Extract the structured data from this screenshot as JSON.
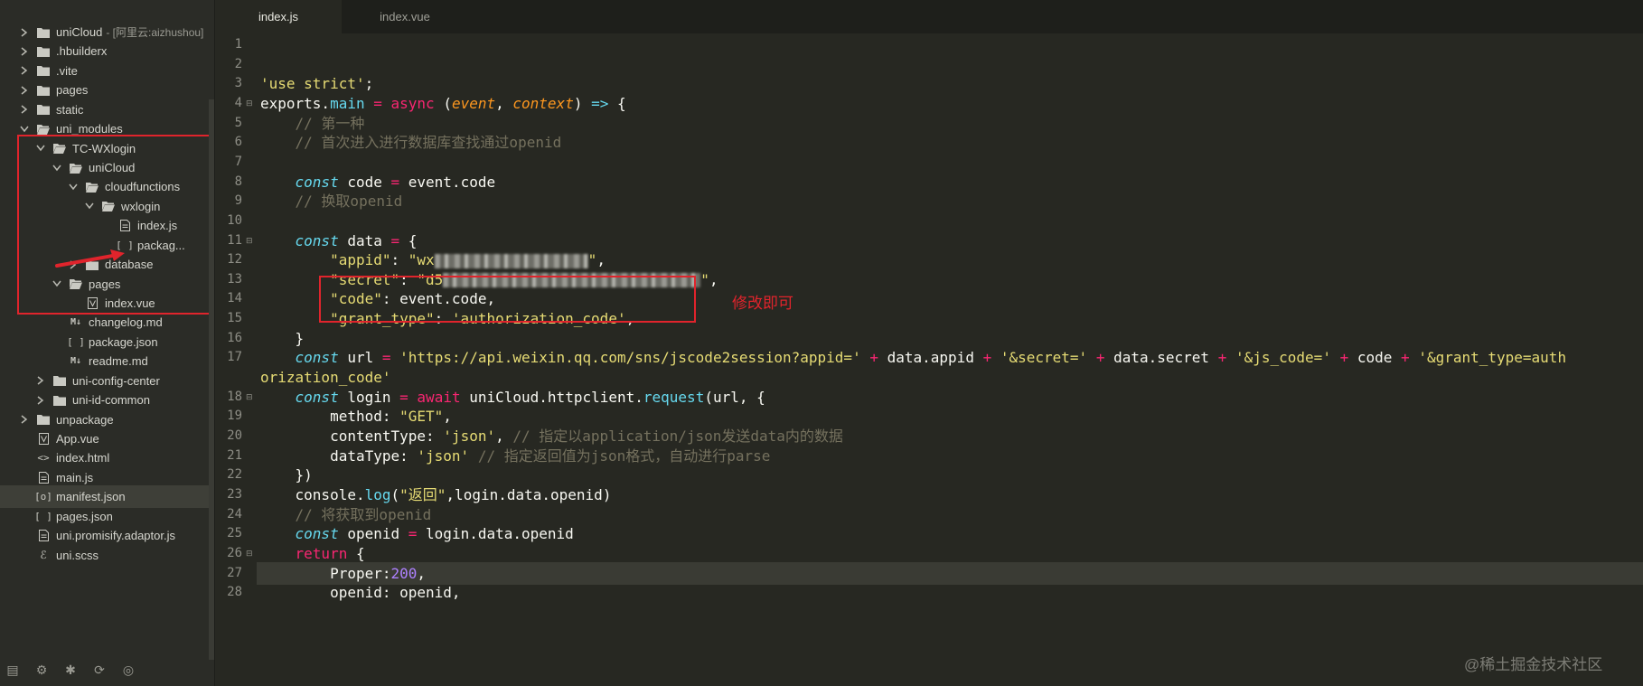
{
  "sidebar": {
    "items": [
      {
        "label": "uniCloud",
        "sub": "- [阿里云:aizhushou]",
        "depth": 0,
        "expand": "collapsed",
        "icon": "folder"
      },
      {
        "label": ".hbuilderx",
        "depth": 0,
        "expand": "collapsed",
        "icon": "folder"
      },
      {
        "label": ".vite",
        "depth": 0,
        "expand": "collapsed",
        "icon": "folder"
      },
      {
        "label": "pages",
        "depth": 0,
        "expand": "collapsed",
        "icon": "folder"
      },
      {
        "label": "static",
        "depth": 0,
        "expand": "collapsed",
        "icon": "folder"
      },
      {
        "label": "uni_modules",
        "depth": 0,
        "expand": "expanded",
        "icon": "folder-open"
      },
      {
        "label": "TC-WXlogin",
        "depth": 1,
        "expand": "expanded",
        "icon": "folder-open"
      },
      {
        "label": "uniCloud",
        "depth": 2,
        "expand": "expanded",
        "icon": "folder-open"
      },
      {
        "label": "cloudfunctions",
        "depth": 3,
        "expand": "expanded",
        "icon": "folder-open"
      },
      {
        "label": "wxlogin",
        "depth": 4,
        "expand": "expanded",
        "icon": "folder-open"
      },
      {
        "label": "index.js",
        "depth": 5,
        "expand": "none",
        "icon": "file"
      },
      {
        "label": "packag...",
        "depth": 5,
        "expand": "none",
        "icon": "json"
      },
      {
        "label": "database",
        "depth": 3,
        "expand": "collapsed",
        "icon": "folder"
      },
      {
        "label": "pages",
        "depth": 2,
        "expand": "expanded",
        "icon": "folder-open"
      },
      {
        "label": "index.vue",
        "depth": 3,
        "expand": "none",
        "icon": "vue"
      },
      {
        "label": "changelog.md",
        "depth": 2,
        "expand": "none",
        "icon": "md"
      },
      {
        "label": "package.json",
        "depth": 2,
        "expand": "none",
        "icon": "json"
      },
      {
        "label": "readme.md",
        "depth": 2,
        "expand": "none",
        "icon": "md"
      },
      {
        "label": "uni-config-center",
        "depth": 1,
        "expand": "collapsed",
        "icon": "folder"
      },
      {
        "label": "uni-id-common",
        "depth": 1,
        "expand": "collapsed",
        "icon": "folder"
      },
      {
        "label": "unpackage",
        "depth": 0,
        "expand": "collapsed",
        "icon": "folder"
      },
      {
        "label": "App.vue",
        "depth": 0,
        "expand": "none",
        "icon": "vue"
      },
      {
        "label": "index.html",
        "depth": 0,
        "expand": "none",
        "icon": "html"
      },
      {
        "label": "main.js",
        "depth": 0,
        "expand": "none",
        "icon": "file"
      },
      {
        "label": "manifest.json",
        "depth": 0,
        "expand": "none",
        "icon": "manifest",
        "selected": true
      },
      {
        "label": "pages.json",
        "depth": 0,
        "expand": "none",
        "icon": "json"
      },
      {
        "label": "uni.promisify.adaptor.js",
        "depth": 0,
        "expand": "none",
        "icon": "file"
      },
      {
        "label": "uni.scss",
        "depth": 0,
        "expand": "none",
        "icon": "scss"
      }
    ],
    "toolbar_icons": [
      "files-icon",
      "debug-icon",
      "bug-icon",
      "git-icon",
      "plugin-icon"
    ]
  },
  "tabs": [
    {
      "label": "index.js",
      "active": true
    },
    {
      "label": "index.vue",
      "active": false
    }
  ],
  "editor": {
    "lines": [
      {
        "n": "1",
        "fold": false,
        "tokens": []
      },
      {
        "n": "2",
        "fold": false,
        "tokens": []
      },
      {
        "n": "3",
        "fold": false,
        "tokens": [
          {
            "c": "str",
            "t": "'use strict'"
          },
          {
            "c": "",
            "t": ";"
          }
        ]
      },
      {
        "n": "4",
        "fold": true,
        "tokens": [
          {
            "c": "",
            "t": "exports."
          },
          {
            "c": "fn",
            "t": "main"
          },
          {
            "c": "",
            "t": " "
          },
          {
            "c": "kw",
            "t": "="
          },
          {
            "c": "",
            "t": " "
          },
          {
            "c": "kw",
            "t": "async"
          },
          {
            "c": "",
            "t": " ("
          },
          {
            "c": "param",
            "t": "event"
          },
          {
            "c": "",
            "t": ", "
          },
          {
            "c": "param",
            "t": "context"
          },
          {
            "c": "",
            "t": ") "
          },
          {
            "c": "fn",
            "t": "=>"
          },
          {
            "c": "",
            "t": " {"
          }
        ]
      },
      {
        "n": "5",
        "fold": false,
        "tokens": [
          {
            "c": "",
            "t": "    "
          },
          {
            "c": "cm",
            "t": "// 第一种"
          }
        ]
      },
      {
        "n": "6",
        "fold": false,
        "tokens": [
          {
            "c": "",
            "t": "    "
          },
          {
            "c": "cm",
            "t": "// 首次进入进行数据库查找通过openid"
          }
        ]
      },
      {
        "n": "7",
        "fold": false,
        "tokens": []
      },
      {
        "n": "8",
        "fold": false,
        "tokens": [
          {
            "c": "",
            "t": "    "
          },
          {
            "c": "con",
            "t": "const"
          },
          {
            "c": "",
            "t": " code "
          },
          {
            "c": "kw",
            "t": "="
          },
          {
            "c": "",
            "t": " event.code"
          }
        ]
      },
      {
        "n": "9",
        "fold": false,
        "tokens": [
          {
            "c": "",
            "t": "    "
          },
          {
            "c": "cm",
            "t": "// 换取openid"
          }
        ]
      },
      {
        "n": "10",
        "fold": false,
        "tokens": []
      },
      {
        "n": "11",
        "fold": true,
        "tokens": [
          {
            "c": "",
            "t": "    "
          },
          {
            "c": "con",
            "t": "const"
          },
          {
            "c": "",
            "t": " data "
          },
          {
            "c": "kw",
            "t": "="
          },
          {
            "c": "",
            "t": " {"
          }
        ]
      },
      {
        "n": "12",
        "fold": false,
        "tokens": [
          {
            "c": "",
            "t": "        "
          },
          {
            "c": "str",
            "t": "\"appid\""
          },
          {
            "c": "",
            "t": ": "
          },
          {
            "c": "str",
            "t": "\"wx"
          },
          {
            "c": "blur",
            "t": "",
            "w": 170
          },
          {
            "c": "str",
            "t": "\""
          },
          {
            "c": "",
            "t": ","
          }
        ]
      },
      {
        "n": "13",
        "fold": false,
        "tokens": [
          {
            "c": "",
            "t": "        "
          },
          {
            "c": "str",
            "t": "\"secret\""
          },
          {
            "c": "",
            "t": ": "
          },
          {
            "c": "str",
            "t": "\"d5"
          },
          {
            "c": "blur",
            "t": "",
            "w": 285
          },
          {
            "c": "str",
            "t": "\""
          },
          {
            "c": "",
            "t": ","
          }
        ]
      },
      {
        "n": "14",
        "fold": false,
        "tokens": [
          {
            "c": "",
            "t": "        "
          },
          {
            "c": "str",
            "t": "\"code\""
          },
          {
            "c": "",
            "t": ": event.code,"
          }
        ]
      },
      {
        "n": "15",
        "fold": false,
        "tokens": [
          {
            "c": "",
            "t": "        "
          },
          {
            "c": "str",
            "t": "\"grant_type\""
          },
          {
            "c": "",
            "t": ": "
          },
          {
            "c": "str",
            "t": "'authorization_code'"
          },
          {
            "c": "",
            "t": ","
          }
        ]
      },
      {
        "n": "16",
        "fold": false,
        "tokens": [
          {
            "c": "",
            "t": "    }"
          }
        ]
      },
      {
        "n": "17",
        "fold": false,
        "tokens": [
          {
            "c": "",
            "t": "    "
          },
          {
            "c": "con",
            "t": "const"
          },
          {
            "c": "",
            "t": " url "
          },
          {
            "c": "kw",
            "t": "="
          },
          {
            "c": "",
            "t": " "
          },
          {
            "c": "str",
            "t": "'https://api.weixin.qq.com/sns/jscode2session?appid='"
          },
          {
            "c": "",
            "t": " "
          },
          {
            "c": "kw",
            "t": "+"
          },
          {
            "c": "",
            "t": " data.appid "
          },
          {
            "c": "kw",
            "t": "+"
          },
          {
            "c": "",
            "t": " "
          },
          {
            "c": "str",
            "t": "'&secret='"
          },
          {
            "c": "",
            "t": " "
          },
          {
            "c": "kw",
            "t": "+"
          },
          {
            "c": "",
            "t": " data.secret "
          },
          {
            "c": "kw",
            "t": "+"
          },
          {
            "c": "",
            "t": " "
          },
          {
            "c": "str",
            "t": "'&js_code='"
          },
          {
            "c": "",
            "t": " "
          },
          {
            "c": "kw",
            "t": "+"
          },
          {
            "c": "",
            "t": " code "
          },
          {
            "c": "kw",
            "t": "+"
          },
          {
            "c": "",
            "t": " "
          },
          {
            "c": "str",
            "t": "'&grant_type=auth"
          }
        ]
      },
      {
        "n": "",
        "fold": false,
        "tokens": [
          {
            "c": "str",
            "t": "orization_code'"
          }
        ]
      },
      {
        "n": "18",
        "fold": true,
        "tokens": [
          {
            "c": "",
            "t": "    "
          },
          {
            "c": "con",
            "t": "const"
          },
          {
            "c": "",
            "t": " login "
          },
          {
            "c": "kw",
            "t": "="
          },
          {
            "c": "",
            "t": " "
          },
          {
            "c": "kw",
            "t": "await"
          },
          {
            "c": "",
            "t": " uniCloud.httpclient."
          },
          {
            "c": "fn",
            "t": "request"
          },
          {
            "c": "",
            "t": "(url, {"
          }
        ]
      },
      {
        "n": "19",
        "fold": false,
        "tokens": [
          {
            "c": "",
            "t": "        method: "
          },
          {
            "c": "str",
            "t": "\"GET\""
          },
          {
            "c": "",
            "t": ","
          }
        ]
      },
      {
        "n": "20",
        "fold": false,
        "tokens": [
          {
            "c": "",
            "t": "        contentType: "
          },
          {
            "c": "str",
            "t": "'json'"
          },
          {
            "c": "",
            "t": ", "
          },
          {
            "c": "cm",
            "t": "// 指定以application/json发送data内的数据"
          }
        ]
      },
      {
        "n": "21",
        "fold": false,
        "tokens": [
          {
            "c": "",
            "t": "        dataType: "
          },
          {
            "c": "str",
            "t": "'json'"
          },
          {
            "c": "",
            "t": " "
          },
          {
            "c": "cm",
            "t": "// 指定返回值为json格式，自动进行parse"
          }
        ]
      },
      {
        "n": "22",
        "fold": false,
        "tokens": [
          {
            "c": "",
            "t": "    })"
          }
        ]
      },
      {
        "n": "23",
        "fold": false,
        "tokens": [
          {
            "c": "",
            "t": "    console."
          },
          {
            "c": "fn",
            "t": "log"
          },
          {
            "c": "",
            "t": "("
          },
          {
            "c": "str",
            "t": "\"返回\""
          },
          {
            "c": "",
            "t": ",login.data.openid)"
          }
        ]
      },
      {
        "n": "24",
        "fold": false,
        "tokens": [
          {
            "c": "",
            "t": "    "
          },
          {
            "c": "cm",
            "t": "// 将获取到openid"
          }
        ]
      },
      {
        "n": "25",
        "fold": false,
        "tokens": [
          {
            "c": "",
            "t": "    "
          },
          {
            "c": "con",
            "t": "const"
          },
          {
            "c": "",
            "t": " openid "
          },
          {
            "c": "kw",
            "t": "="
          },
          {
            "c": "",
            "t": " login.data.openid"
          }
        ]
      },
      {
        "n": "26",
        "fold": true,
        "tokens": [
          {
            "c": "",
            "t": "    "
          },
          {
            "c": "kw",
            "t": "return"
          },
          {
            "c": "",
            "t": " {"
          }
        ]
      },
      {
        "n": "27",
        "fold": false,
        "current": true,
        "tokens": [
          {
            "c": "",
            "t": "        Proper:"
          },
          {
            "c": "num",
            "t": "200"
          },
          {
            "c": "",
            "t": ","
          }
        ]
      },
      {
        "n": "28",
        "fold": false,
        "tokens": [
          {
            "c": "",
            "t": "        openid: openid,"
          }
        ]
      }
    ]
  },
  "annotation_note": "修改即可",
  "watermark": "@稀土掘金技术社区",
  "colors": {
    "highlight_box": "#e0242c",
    "background": "#272822"
  }
}
